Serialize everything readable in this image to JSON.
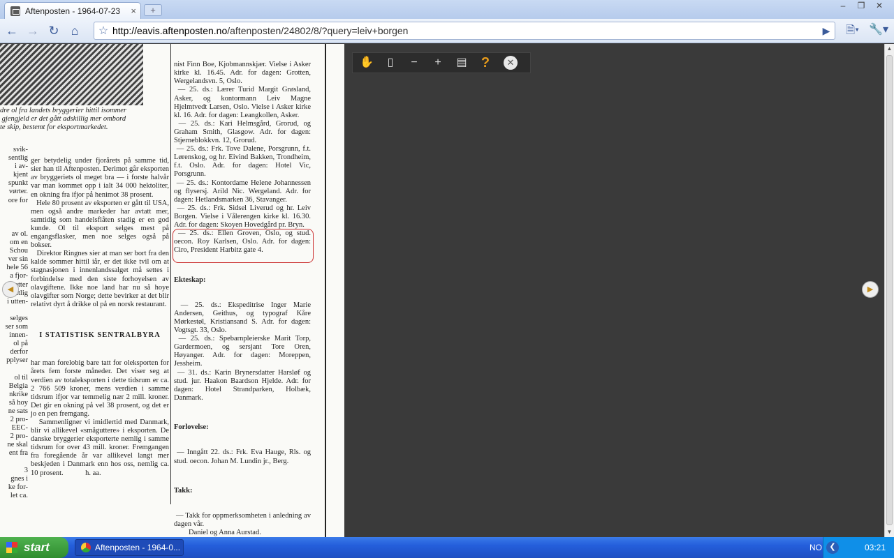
{
  "browser": {
    "tab_title": "Aftenposten - 1964-07-23",
    "tab_close": "×",
    "new_tab": "+",
    "url_host": "http://eavis.aftenposten.no",
    "url_path": "/aftenposten/24802/8/?query=leiv+borgen",
    "window_controls": [
      "‒",
      "❐",
      "✕"
    ]
  },
  "newspaper": {
    "caption": "dre ol fra landets bryggerier hittil isommer\n gjengjeld er det gått adskillig mer ombord\nte skip, bestemt for eksportmarkedet.",
    "col_a": "svik-\nsentlig\ni av-\nkjent\nspunkt\nvørter.\nore for\n\n\n\nav ol.\nom en\nSchou\nver sin\nhele 56\na fjor-\nDetter\nsentlig\ni utten-\n\nselges\nser som\ninnen-\nol på\nderfor\npplyser\n\nol til\nBelgia\nnkrike\nså hoy\nne sats\n2 pro-\nEEC-\n2 pro-\nne skal\nent fra\n\n3\ngnes i\nke for-\nlet ca.",
    "col_b_top": "ger betydelig under fjorårets på samme tid, sier han til Aftenposten. Derimot går eksporten av bryggeriets ol meget bra — i forste halvår var man kommet opp i ialt 34 000 hektoliter, en okning fra ifjor på henimot 38 prosent.\n   Hele 80 prosent av eksporten er gått til USA, men også andre markeder har avtatt mer, samtidig som handelsflåten stadig er en god kunde. Ol til eksport selges mest på engangsflasker, men noe selges også på bokser.\n   Direktor Ringnes sier at man ser bort fra den kalde sommer hittil iår, er det ikke tvil om at stagnasjonen i innenlandssalget må settes i forbindelse med den siste forhoyelsen av olavgiftene. Ikke noe land har nu så hoye olavgifter som Norge; dette bevirker at det blir relativt dyrt å drikke ol på en norsk restaurant.",
    "col_b_heading": "I STATISTISK SENTRALBYRA",
    "col_b_bottom": "har man forelobig bare tatt for oleksporten for årets fem forste måneder. Det viser seg at verdien av totaleksporten i dette tidsrum er ca. 2 766 509 kroner, mens verdien i samme tidsrum ifjor var temmelig nær 2 mill. kroner. Det gir en okning på vel 38 prosent, og det er jo en pen fremgang.\n   Sammenligner vi imidlertid med Danmark, blir vi allikevel «småguttere» i eksporten. De danske bryggerier eksporterte nemlig i samme tidsrum for over 43 mill. kroner. Fremgangen fra foregående år var allikevel langt mer beskjeden i Danmark enn hos oss, nemlig ca. 10 prosent.            h. aa.",
    "col_c_weddings": "nist Finn Boe, Kjobmannskjær. Vielse i Asker kirke kl. 16.45. Adr. for dagen: Grotten, Wergelandsvn. 5, Oslo.\n — 25. ds.: Lærer Turid Margit Grøsland, Asker, og kontormann Leiv Magne Hjelmtvedt Larsen, Oslo. Vielse i Asker kirke kl. 16. Adr. for dagen: Leangkollen, Asker.\n — 25. ds.: Kari Helmsgård, Grorud, og Graham Smith, Glasgow. Adr. for dagen: Stjerneblokkvn. 12, Grorud.\n — 25. ds.: Frk. Tove Dalene, Porsgrunn, f.t. Lørenskog, og hr. Eivind Bakken, Trondheim, f.t. Oslo. Adr. for dagen: Hotel Vic, Porsgrunn.\n — 25. ds.: Kontordame Helene Johannessen og flysersj. Arild Nic. Wergeland. Adr. for dagen: Hetlandsmarken 36, Stavanger.\n — 25. ds.: Frk. Sidsel Liverud og hr. Leiv Borgen. Vielse i Vålerengen kirke kl. 16.30. Adr. for dagen: Skoyen Hovedgård pr. Bryn.\n — 25. ds.: Ellen Groven, Oslo, og stud. oecon. Roy Karlsen, Oslo. Adr. for dagen: Ciro, President Harbitz gate 4.",
    "col_c_marriage_head": "Ekteskap:",
    "col_c_marriage": " — 25. ds.: Ekspeditrise Inger Marie Andersen, Geithus, og typograf Kåre Mørkestøl, Kristiansand S. Adr. for dagen: Vogtsgt. 33, Oslo.\n — 25. ds.: Spebarnpleierske Marit Torp, Gardermoen, og sersjant Tore Oren, Høyanger. Adr. for dagen: Moreppen, Jessheim.\n — 31. ds.: Karin Brynersdatter Harsløf og stud. jur. Haakon Baardson Hjelde. Adr. for dagen: Hotel Strandparken, Holbæk, Danmark.",
    "col_c_engagement_head": "Forlovelse:",
    "col_c_engagement": " — Inngått 22. ds.: Frk. Eva Hauge, Rls. og stud. oecon. Johan M. Lundin jr., Berg.",
    "col_c_thanks_head": "Takk:",
    "col_c_thanks": " — Takk for oppmerksomheten i anledning av dagen vår.\n        Daniel og Anna Aurstad."
  },
  "viewer_tools": {
    "pan": "✋",
    "clip": "▯",
    "zoom_out": "−",
    "zoom_in": "+",
    "pages": "▤",
    "help": "?",
    "close": "✕"
  },
  "navigation": {
    "prev": "◀",
    "next": "▶"
  },
  "scrollbar": {
    "up": "▲",
    "down": "▼"
  },
  "taskbar": {
    "start_label": "start",
    "task_label": "Aftenposten - 1964-0...",
    "language": "NO",
    "tray_chevron": "❮",
    "clock": "03:21"
  }
}
